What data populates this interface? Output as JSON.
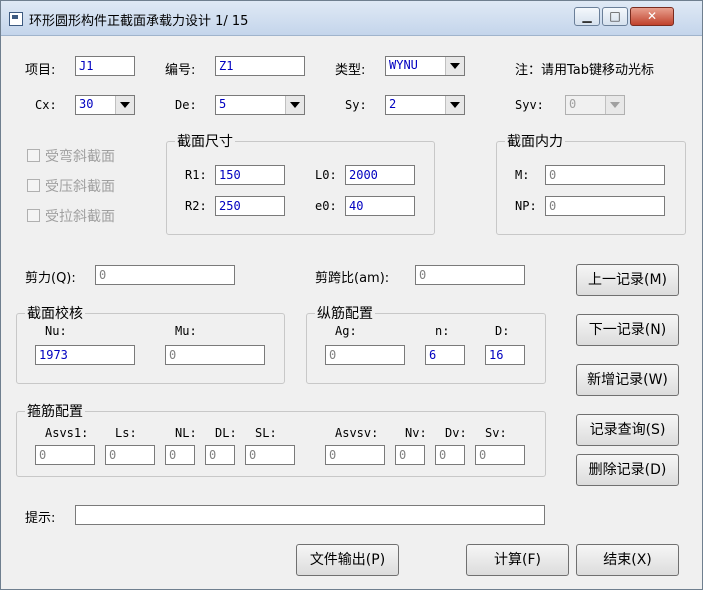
{
  "window": {
    "title": "环形圆形构件正截面承载力设计 1/ 15"
  },
  "top": {
    "item_label": "项目:",
    "item_value": "J1",
    "code_label": "编号:",
    "code_value": "Z1",
    "type_label": "类型:",
    "type_value": "WYNU",
    "note": "注：请用Tab键移动光标",
    "cx_label": "Cx:",
    "cx_value": "30",
    "de_label": "De:",
    "de_value": "5",
    "sy_label": "Sy:",
    "sy_value": "2",
    "syv_label": "Syv:",
    "syv_value": "0"
  },
  "checks": [
    "受弯斜截面",
    "受压斜截面",
    "受拉斜截面"
  ],
  "section_size": {
    "title": "截面尺寸",
    "r1_label": "R1:",
    "r1_value": "150",
    "l0_label": "L0:",
    "l0_value": "2000",
    "r2_label": "R2:",
    "r2_value": "250",
    "e0_label": "e0:",
    "e0_value": "40"
  },
  "section_force": {
    "title": "截面内力",
    "m_label": "M:",
    "m_value": "0",
    "np_label": "NP:",
    "np_value": "0"
  },
  "shear": {
    "label": "剪力(Q):",
    "value": "0",
    "ratio_label": "剪跨比(am):",
    "ratio_value": "0"
  },
  "check": {
    "title": "截面校核",
    "nu_label": "Nu:",
    "nu_value": "1973",
    "mu_label": "Mu:",
    "mu_value": "0"
  },
  "long_rebar": {
    "title": "纵筋配置",
    "ag_label": "Ag:",
    "ag_value": "0",
    "n_label": "n:",
    "n_value": "6",
    "d_label": "D:",
    "d_value": "16"
  },
  "stirrup": {
    "title": "箍筋配置",
    "fields": [
      {
        "label": "Asvs1:",
        "value": "0"
      },
      {
        "label": "Ls:",
        "value": "0"
      },
      {
        "label": "NL:",
        "value": "0"
      },
      {
        "label": "DL:",
        "value": "0"
      },
      {
        "label": "SL:",
        "value": "0"
      },
      {
        "label": "Asvsv:",
        "value": "0"
      },
      {
        "label": "Nv:",
        "value": "0"
      },
      {
        "label": "Dv:",
        "value": "0"
      },
      {
        "label": "Sv:",
        "value": "0"
      }
    ]
  },
  "hint": {
    "label": "提示:",
    "value": ""
  },
  "buttons": {
    "prev": "上一记录(M)",
    "next": "下一记录(N)",
    "add": "新增记录(W)",
    "query": "记录查询(S)",
    "delete": "删除记录(D)",
    "export": "文件输出(P)",
    "calc": "计算(F)",
    "end": "结束(X)"
  }
}
